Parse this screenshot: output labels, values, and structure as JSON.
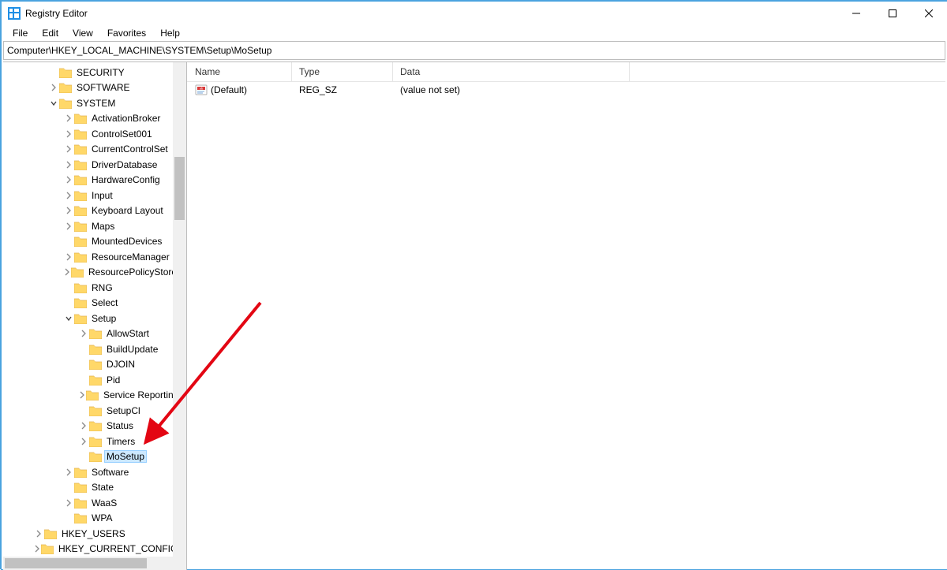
{
  "window": {
    "title": "Registry Editor"
  },
  "menu": {
    "file": "File",
    "edit": "Edit",
    "view": "View",
    "favorites": "Favorites",
    "help": "Help"
  },
  "address": "Computer\\HKEY_LOCAL_MACHINE\\SYSTEM\\Setup\\MoSetup",
  "columns": {
    "name": "Name",
    "type": "Type",
    "data": "Data"
  },
  "values": [
    {
      "name": "(Default)",
      "type": "REG_SZ",
      "data": "(value not set)"
    }
  ],
  "tree": [
    {
      "depth": 3,
      "expander": "none",
      "label": "SECURITY"
    },
    {
      "depth": 3,
      "expander": "collapsed",
      "label": "SOFTWARE"
    },
    {
      "depth": 3,
      "expander": "expanded",
      "label": "SYSTEM"
    },
    {
      "depth": 4,
      "expander": "collapsed",
      "label": "ActivationBroker"
    },
    {
      "depth": 4,
      "expander": "collapsed",
      "label": "ControlSet001"
    },
    {
      "depth": 4,
      "expander": "collapsed",
      "label": "CurrentControlSet"
    },
    {
      "depth": 4,
      "expander": "collapsed",
      "label": "DriverDatabase"
    },
    {
      "depth": 4,
      "expander": "collapsed",
      "label": "HardwareConfig"
    },
    {
      "depth": 4,
      "expander": "collapsed",
      "label": "Input"
    },
    {
      "depth": 4,
      "expander": "collapsed",
      "label": "Keyboard Layout"
    },
    {
      "depth": 4,
      "expander": "collapsed",
      "label": "Maps"
    },
    {
      "depth": 4,
      "expander": "none",
      "label": "MountedDevices"
    },
    {
      "depth": 4,
      "expander": "collapsed",
      "label": "ResourceManager"
    },
    {
      "depth": 4,
      "expander": "collapsed",
      "label": "ResourcePolicyStore"
    },
    {
      "depth": 4,
      "expander": "none",
      "label": "RNG"
    },
    {
      "depth": 4,
      "expander": "none",
      "label": "Select"
    },
    {
      "depth": 4,
      "expander": "expanded",
      "label": "Setup"
    },
    {
      "depth": 5,
      "expander": "collapsed",
      "label": "AllowStart"
    },
    {
      "depth": 5,
      "expander": "none",
      "label": "BuildUpdate"
    },
    {
      "depth": 5,
      "expander": "none",
      "label": "DJOIN"
    },
    {
      "depth": 5,
      "expander": "none",
      "label": "Pid"
    },
    {
      "depth": 5,
      "expander": "collapsed",
      "label": "Service Reporting"
    },
    {
      "depth": 5,
      "expander": "none",
      "label": "SetupCl"
    },
    {
      "depth": 5,
      "expander": "collapsed",
      "label": "Status"
    },
    {
      "depth": 5,
      "expander": "collapsed",
      "label": "Timers"
    },
    {
      "depth": 5,
      "expander": "none",
      "label": "MoSetup",
      "selected": true
    },
    {
      "depth": 4,
      "expander": "collapsed",
      "label": "Software"
    },
    {
      "depth": 4,
      "expander": "none",
      "label": "State"
    },
    {
      "depth": 4,
      "expander": "collapsed",
      "label": "WaaS"
    },
    {
      "depth": 4,
      "expander": "none",
      "label": "WPA"
    },
    {
      "depth": 2,
      "expander": "collapsed",
      "label": "HKEY_USERS"
    },
    {
      "depth": 2,
      "expander": "collapsed",
      "label": "HKEY_CURRENT_CONFIG"
    }
  ]
}
